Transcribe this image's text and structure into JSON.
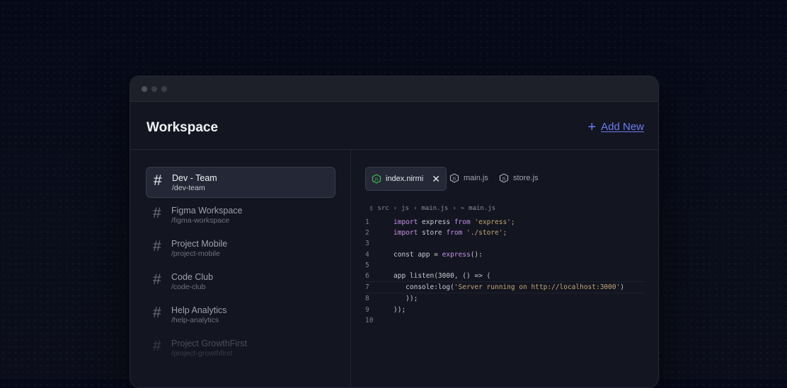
{
  "header": {
    "title": "Workspace",
    "add_new_label": "Add New"
  },
  "channels": [
    {
      "name": "Dev - Team",
      "path": "/dev-team",
      "active": true
    },
    {
      "name": "Figma Workspace",
      "path": "/figma-workspace"
    },
    {
      "name": "Project Mobile",
      "path": "/project-mobile"
    },
    {
      "name": "Code Club",
      "path": "/code-club"
    },
    {
      "name": "Help Analytics",
      "path": "/help-analytics"
    },
    {
      "name": "Project GrowthFirst",
      "path": "/project-growthfirst"
    }
  ],
  "tabs": [
    {
      "label": "index.nirmi",
      "active": true,
      "icon": "nodejs-icon"
    },
    {
      "label": "main.js",
      "icon": "nodejs-icon"
    },
    {
      "label": "store.js",
      "icon": "nodejs-icon"
    }
  ],
  "breadcrumb": [
    "src",
    "js",
    "main.js",
    "main.js"
  ],
  "code": {
    "line_numbers": [
      "1",
      "2",
      "3",
      "4",
      "5",
      "6",
      "7",
      "8",
      "9",
      "10"
    ],
    "l1": {
      "kw1": "import",
      "id": " express ",
      "kw2": "from",
      "str": " 'express';"
    },
    "l2": {
      "kw1": "import",
      "id": " store ",
      "kw2": "from",
      "str": " './store';"
    },
    "l4": {
      "pre": "const app = ",
      "fn": "express",
      "post": "():"
    },
    "l6": "app listen(3000, () => (",
    "l7": {
      "pre": "   console:log(",
      "str": "'Server running on http://localhost:3000'",
      "post": ")"
    },
    "l8": "   ));",
    "l9": "));"
  },
  "colors": {
    "accent": "#6d7cf5",
    "node_green": "#3fb950"
  }
}
